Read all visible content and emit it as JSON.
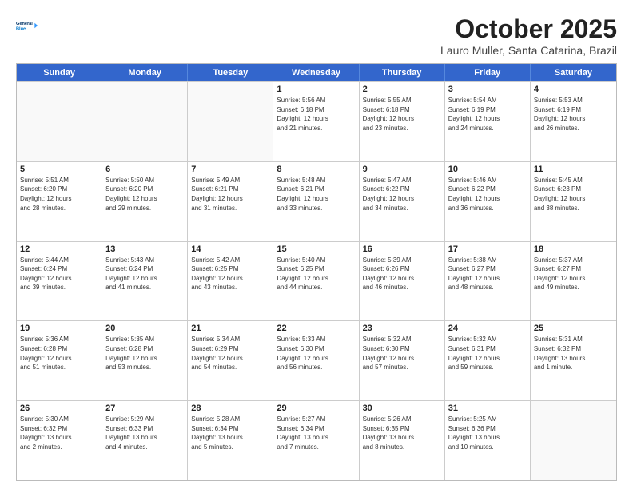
{
  "header": {
    "logo_line1": "General",
    "logo_line2": "Blue",
    "month": "October 2025",
    "location": "Lauro Muller, Santa Catarina, Brazil"
  },
  "weekdays": [
    "Sunday",
    "Monday",
    "Tuesday",
    "Wednesday",
    "Thursday",
    "Friday",
    "Saturday"
  ],
  "rows": [
    [
      {
        "day": "",
        "info": ""
      },
      {
        "day": "",
        "info": ""
      },
      {
        "day": "",
        "info": ""
      },
      {
        "day": "1",
        "info": "Sunrise: 5:56 AM\nSunset: 6:18 PM\nDaylight: 12 hours\nand 21 minutes."
      },
      {
        "day": "2",
        "info": "Sunrise: 5:55 AM\nSunset: 6:18 PM\nDaylight: 12 hours\nand 23 minutes."
      },
      {
        "day": "3",
        "info": "Sunrise: 5:54 AM\nSunset: 6:19 PM\nDaylight: 12 hours\nand 24 minutes."
      },
      {
        "day": "4",
        "info": "Sunrise: 5:53 AM\nSunset: 6:19 PM\nDaylight: 12 hours\nand 26 minutes."
      }
    ],
    [
      {
        "day": "5",
        "info": "Sunrise: 5:51 AM\nSunset: 6:20 PM\nDaylight: 12 hours\nand 28 minutes."
      },
      {
        "day": "6",
        "info": "Sunrise: 5:50 AM\nSunset: 6:20 PM\nDaylight: 12 hours\nand 29 minutes."
      },
      {
        "day": "7",
        "info": "Sunrise: 5:49 AM\nSunset: 6:21 PM\nDaylight: 12 hours\nand 31 minutes."
      },
      {
        "day": "8",
        "info": "Sunrise: 5:48 AM\nSunset: 6:21 PM\nDaylight: 12 hours\nand 33 minutes."
      },
      {
        "day": "9",
        "info": "Sunrise: 5:47 AM\nSunset: 6:22 PM\nDaylight: 12 hours\nand 34 minutes."
      },
      {
        "day": "10",
        "info": "Sunrise: 5:46 AM\nSunset: 6:22 PM\nDaylight: 12 hours\nand 36 minutes."
      },
      {
        "day": "11",
        "info": "Sunrise: 5:45 AM\nSunset: 6:23 PM\nDaylight: 12 hours\nand 38 minutes."
      }
    ],
    [
      {
        "day": "12",
        "info": "Sunrise: 5:44 AM\nSunset: 6:24 PM\nDaylight: 12 hours\nand 39 minutes."
      },
      {
        "day": "13",
        "info": "Sunrise: 5:43 AM\nSunset: 6:24 PM\nDaylight: 12 hours\nand 41 minutes."
      },
      {
        "day": "14",
        "info": "Sunrise: 5:42 AM\nSunset: 6:25 PM\nDaylight: 12 hours\nand 43 minutes."
      },
      {
        "day": "15",
        "info": "Sunrise: 5:40 AM\nSunset: 6:25 PM\nDaylight: 12 hours\nand 44 minutes."
      },
      {
        "day": "16",
        "info": "Sunrise: 5:39 AM\nSunset: 6:26 PM\nDaylight: 12 hours\nand 46 minutes."
      },
      {
        "day": "17",
        "info": "Sunrise: 5:38 AM\nSunset: 6:27 PM\nDaylight: 12 hours\nand 48 minutes."
      },
      {
        "day": "18",
        "info": "Sunrise: 5:37 AM\nSunset: 6:27 PM\nDaylight: 12 hours\nand 49 minutes."
      }
    ],
    [
      {
        "day": "19",
        "info": "Sunrise: 5:36 AM\nSunset: 6:28 PM\nDaylight: 12 hours\nand 51 minutes."
      },
      {
        "day": "20",
        "info": "Sunrise: 5:35 AM\nSunset: 6:28 PM\nDaylight: 12 hours\nand 53 minutes."
      },
      {
        "day": "21",
        "info": "Sunrise: 5:34 AM\nSunset: 6:29 PM\nDaylight: 12 hours\nand 54 minutes."
      },
      {
        "day": "22",
        "info": "Sunrise: 5:33 AM\nSunset: 6:30 PM\nDaylight: 12 hours\nand 56 minutes."
      },
      {
        "day": "23",
        "info": "Sunrise: 5:32 AM\nSunset: 6:30 PM\nDaylight: 12 hours\nand 57 minutes."
      },
      {
        "day": "24",
        "info": "Sunrise: 5:32 AM\nSunset: 6:31 PM\nDaylight: 12 hours\nand 59 minutes."
      },
      {
        "day": "25",
        "info": "Sunrise: 5:31 AM\nSunset: 6:32 PM\nDaylight: 13 hours\nand 1 minute."
      }
    ],
    [
      {
        "day": "26",
        "info": "Sunrise: 5:30 AM\nSunset: 6:32 PM\nDaylight: 13 hours\nand 2 minutes."
      },
      {
        "day": "27",
        "info": "Sunrise: 5:29 AM\nSunset: 6:33 PM\nDaylight: 13 hours\nand 4 minutes."
      },
      {
        "day": "28",
        "info": "Sunrise: 5:28 AM\nSunset: 6:34 PM\nDaylight: 13 hours\nand 5 minutes."
      },
      {
        "day": "29",
        "info": "Sunrise: 5:27 AM\nSunset: 6:34 PM\nDaylight: 13 hours\nand 7 minutes."
      },
      {
        "day": "30",
        "info": "Sunrise: 5:26 AM\nSunset: 6:35 PM\nDaylight: 13 hours\nand 8 minutes."
      },
      {
        "day": "31",
        "info": "Sunrise: 5:25 AM\nSunset: 6:36 PM\nDaylight: 13 hours\nand 10 minutes."
      },
      {
        "day": "",
        "info": ""
      }
    ]
  ]
}
